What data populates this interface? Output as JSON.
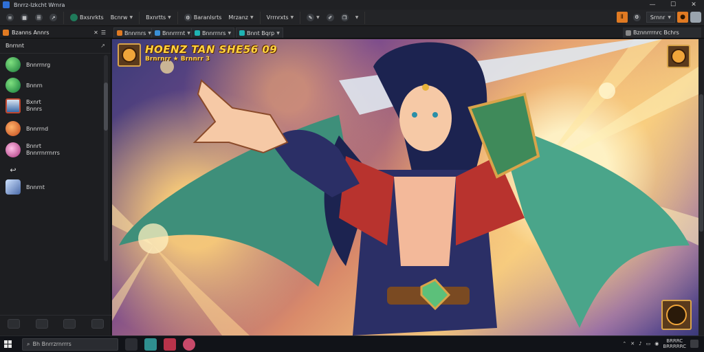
{
  "window": {
    "title": "Bnrrz-Izkcht Wrnra"
  },
  "win_controls": {
    "minimize": "—",
    "maximize": "☐",
    "close": "✕"
  },
  "toolbar": {
    "groups": [
      [
        "Bxsnrkts",
        "Bcnrw"
      ],
      [
        "Bxnrtts"
      ],
      [
        "Baranlsrts",
        "Mrzanz"
      ],
      [
        "Vrrnrxts"
      ]
    ],
    "field_label": "Srnnr"
  },
  "tabs": {
    "left_panel_tab": "Bzanns  Annrs",
    "documents": [
      "Bnnrnrs",
      "Bnnrrrnt",
      "Bnnrrnrs",
      "Bnnt Bqrp"
    ],
    "right_tab": "Bznnrrrnrc Bchrs"
  },
  "sidebar": {
    "header": "Bnrnnt",
    "items": [
      {
        "label": "Bnnrrnrg",
        "icon": "leaf-icon"
      },
      {
        "label": "Bnnrn",
        "icon": "leaf-icon"
      },
      {
        "label": "Bxnrt\nBnnrs",
        "icon": "book-icon"
      },
      {
        "label": "Bnnrrnd",
        "icon": "fire-icon"
      },
      {
        "label": "Bnnrt\nBnnrrnrrnrrs",
        "icon": "gem-icon"
      },
      {
        "label": "",
        "icon": "arrow-icon"
      },
      {
        "label": "Bnnrnt",
        "icon": "cube-icon"
      }
    ]
  },
  "art": {
    "title": "HOENZ TAN SHE56 09",
    "subtitle": "Brnrnrr ★ Brnnrr 3"
  },
  "taskbar": {
    "search_placeholder": "Bh Bnrrzrnrrrs",
    "clock_time": "BRRRC",
    "clock_date": "BRRRRRC"
  },
  "colors": {
    "accent": "#e07a22",
    "title_gold": "#ffd23f",
    "background": "#1b1c1f"
  }
}
